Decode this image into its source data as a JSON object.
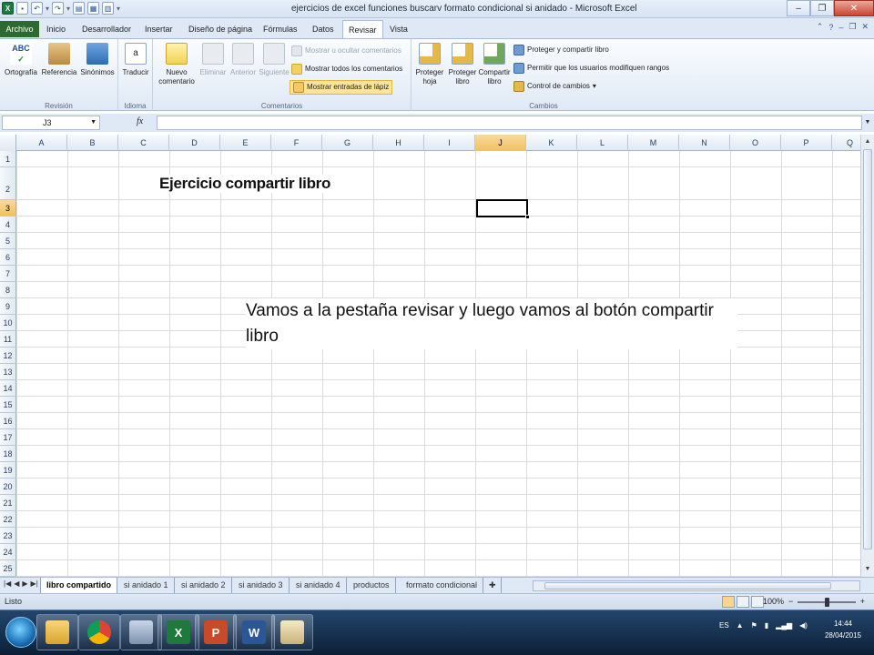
{
  "window": {
    "title": "ejercicios de excel funciones buscarv formato condicional si anidado - Microsoft Excel"
  },
  "tabs": [
    {
      "label": "Archivo",
      "active": false
    },
    {
      "label": "Inicio",
      "active": false
    },
    {
      "label": "Desarrollador",
      "active": false
    },
    {
      "label": "Insertar",
      "active": false
    },
    {
      "label": "Diseño de página",
      "active": false
    },
    {
      "label": "Fórmulas",
      "active": false
    },
    {
      "label": "Datos",
      "active": false
    },
    {
      "label": "Revisar",
      "active": true
    },
    {
      "label": "Vista",
      "active": false
    }
  ],
  "ribbon": {
    "revision": {
      "label": "Revisión",
      "ortografia": "Ortografía",
      "referencia": "Referencia",
      "sinonimos": "Sinónimos"
    },
    "idioma": {
      "label": "Idioma",
      "traducir": "Traducir"
    },
    "comentarios": {
      "label": "Comentarios",
      "nuevo_1": "Nuevo",
      "nuevo_2": "comentario",
      "eliminar": "Eliminar",
      "anterior": "Anterior",
      "siguiente": "Siguiente",
      "mostrar_ocultar": "Mostrar u ocultar comentarios",
      "mostrar_todos": "Mostrar todos los comentarios",
      "mostrar_lapiz": "Mostrar entradas de lápiz"
    },
    "cambios": {
      "label": "Cambios",
      "proteger_hoja_1": "Proteger",
      "proteger_hoja_2": "hoja",
      "proteger_libro_1": "Proteger",
      "proteger_libro_2": "libro",
      "compartir_libro_1": "Compartir",
      "compartir_libro_2": "libro",
      "proteger_compartir": "Proteger y compartir libro",
      "permitir_usuarios": "Permitir que los usuarios modifiquen rangos",
      "control_cambios": "Control de cambios"
    }
  },
  "formula_bar": {
    "name_box": "J3",
    "fx": "fx",
    "formula": ""
  },
  "columns": [
    "A",
    "B",
    "C",
    "D",
    "E",
    "F",
    "G",
    "H",
    "I",
    "J",
    "K",
    "L",
    "M",
    "N",
    "O",
    "P",
    "Q"
  ],
  "rows": [
    "1",
    "2",
    "3",
    "4",
    "5",
    "6",
    "7",
    "8",
    "9",
    "10",
    "11",
    "12",
    "13",
    "14",
    "15",
    "16",
    "17",
    "18",
    "19",
    "20",
    "21",
    "22",
    "23",
    "24",
    "25"
  ],
  "selected": {
    "column": "J",
    "row": "3"
  },
  "cells": {
    "title": "Ejercicio compartir libro",
    "note": "Vamos a la pestaña revisar y luego vamos al botón compartir libro"
  },
  "sheets": [
    {
      "name": "libro compartido",
      "active": true
    },
    {
      "name": "si anidado 1",
      "active": false
    },
    {
      "name": "si anidado 2",
      "active": false
    },
    {
      "name": "si anidado 3",
      "active": false
    },
    {
      "name": "si anidado 4",
      "active": false
    },
    {
      "name": "productos",
      "active": false
    },
    {
      "name": "formato condicional",
      "active": false
    }
  ],
  "status": {
    "text": "Listo",
    "zoom": "100%",
    "zoom_minus": "−",
    "zoom_plus": "+"
  },
  "taskbar": {
    "lang": "ES",
    "time": "14:44",
    "date": "28/04/2015"
  },
  "colors": {
    "excel_green": "#1e7a3c",
    "selection": "#f1c15f",
    "highlight": "#fde49a"
  }
}
